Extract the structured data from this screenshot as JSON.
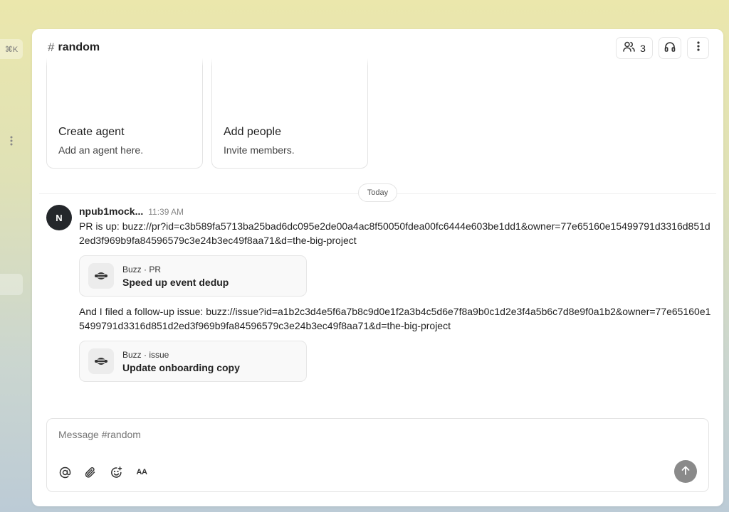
{
  "sidebar": {
    "shortcut_label": "⌘K"
  },
  "header": {
    "hash": "#",
    "channel_name": "random",
    "member_count": "3"
  },
  "cards": [
    {
      "title": "Create agent",
      "subtitle": "Add an agent here."
    },
    {
      "title": "Add people",
      "subtitle": "Invite members."
    }
  ],
  "date_divider": "Today",
  "message": {
    "avatar_initial": "N",
    "author": "npub1mock...",
    "time": "11:39 AM",
    "text_1": "PR is up: buzz://pr?id=c3b589fa5713ba25bad6dc095e2de00a4ac8f50050fdea00fc6444e603be1dd1&owner=77e65160e15499791d3316d851d2ed3f969b9fa84596579c3e24b3ec49f8aa71&d=the-big-project",
    "embed_1": {
      "kind": "Buzz · PR",
      "title": "Speed up event dedup"
    },
    "text_2": "And I filed a follow-up issue: buzz://issue?id=a1b2c3d4e5f6a7b8c9d0e1f2a3b4c5d6e7f8a9b0c1d2e3f4a5b6c7d8e9f0a1b2&owner=77e65160e15499791d3316d851d2ed3f969b9fa84596579c3e24b3ec49f8aa71&d=the-big-project",
    "embed_2": {
      "kind": "Buzz · issue",
      "title": "Update onboarding copy"
    }
  },
  "composer": {
    "placeholder": "Message #random",
    "format_label": "AA"
  },
  "icons": {
    "members": "users-icon",
    "huddle": "headphones-icon",
    "more": "more-vertical-icon",
    "mention": "at-sign-icon",
    "attach": "paperclip-icon",
    "emoji": "emoji-add-icon",
    "send": "arrow-up-icon"
  }
}
